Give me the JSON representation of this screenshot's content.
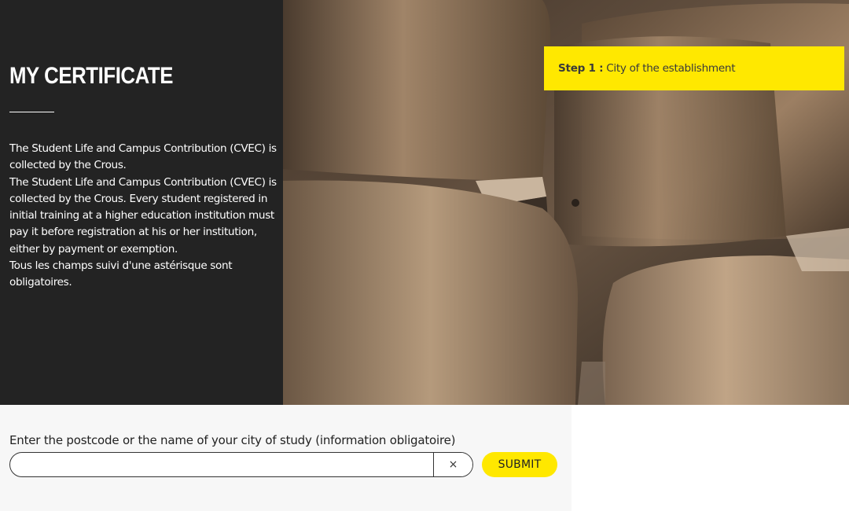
{
  "header": {
    "title": "MY CERTIFICATE"
  },
  "intro": {
    "lines": [
      "The Student Life and Campus Contribution (CVEC) is collected by the Crous.",
      "The Student Life and Campus Contribution (CVEC) is collected by the Crous. Every student registered in initial training at a higher education institution must pay it before registration at his or her institution, either by payment or exemption.",
      "Tous les champs suivi d'une astérisque sont obligatoires."
    ]
  },
  "step": {
    "label": "Step 1 :",
    "text": "City of the establishment"
  },
  "form": {
    "label": "Enter the postcode or the name of your city of study (information obligatoire)",
    "input_value": "",
    "clear_label": "×",
    "submit_label": "SUBMIT"
  },
  "colors": {
    "accent": "#ffe800",
    "panel": "#232323",
    "form_bg": "#f7f7f7"
  }
}
